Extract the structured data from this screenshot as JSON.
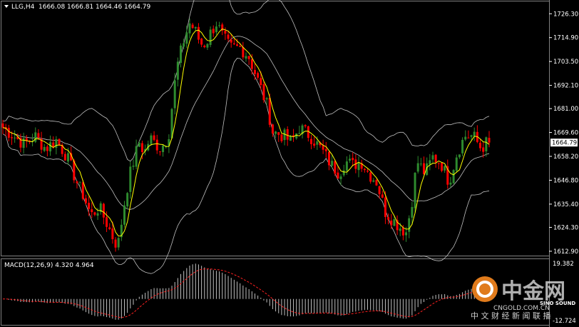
{
  "chart_data": {
    "type": "candlestick",
    "symbol_label": "LLG,H4",
    "ohlc_readout": [
      "1666.08",
      "1666.81",
      "1664.46",
      "1664.79"
    ],
    "current_price": 1664.79,
    "current_price_label": "1664.79",
    "price_ticks": [
      1726.3,
      1714.9,
      1703.5,
      1692.1,
      1681.0,
      1669.6,
      1658.2,
      1646.8,
      1635.4,
      1624.3,
      1612.9
    ],
    "price_tick_labels": [
      "1726.30",
      "1714.90",
      "1703.50",
      "1692.10",
      "1681.00",
      "1669.60",
      "1658.20",
      "1646.80",
      "1635.40",
      "1624.30",
      "1612.90"
    ],
    "ylim": [
      1611.5,
      1731.5
    ],
    "bull_color": "#2e8b2e",
    "bear_color": "#ff0000",
    "candle_count": 165,
    "indicators": {
      "bollinger_color": "#c0c0c0",
      "moving_average_color": "#ffff00"
    },
    "anchors": [
      [
        0,
        1672
      ],
      [
        4,
        1668
      ],
      [
        8,
        1664
      ],
      [
        12,
        1668
      ],
      [
        16,
        1662
      ],
      [
        20,
        1666
      ],
      [
        24,
        1658
      ],
      [
        28,
        1645
      ],
      [
        30,
        1640
      ],
      [
        33,
        1630
      ],
      [
        36,
        1634
      ],
      [
        39,
        1626
      ],
      [
        41,
        1620
      ],
      [
        43,
        1615
      ],
      [
        46,
        1640
      ],
      [
        48,
        1652
      ],
      [
        51,
        1665
      ],
      [
        53,
        1660
      ],
      [
        55,
        1667
      ],
      [
        59,
        1662
      ],
      [
        62,
        1668
      ],
      [
        65,
        1700
      ],
      [
        68,
        1715
      ],
      [
        70,
        1722
      ],
      [
        72,
        1718
      ],
      [
        74,
        1712
      ],
      [
        76,
        1712
      ],
      [
        78,
        1718
      ],
      [
        80,
        1722
      ],
      [
        82,
        1716
      ],
      [
        85,
        1710
      ],
      [
        89,
        1710
      ],
      [
        92,
        1706
      ],
      [
        95,
        1696
      ],
      [
        99,
        1682
      ],
      [
        101,
        1670
      ],
      [
        105,
        1668
      ],
      [
        108,
        1665
      ],
      [
        111,
        1672
      ],
      [
        113,
        1670
      ],
      [
        115,
        1668
      ],
      [
        117,
        1665
      ],
      [
        120,
        1660
      ],
      [
        123,
        1654
      ],
      [
        126,
        1650
      ],
      [
        128,
        1656
      ],
      [
        131,
        1654
      ],
      [
        134,
        1656
      ],
      [
        137,
        1650
      ],
      [
        140,
        1646
      ],
      [
        143,
        1632
      ],
      [
        146,
        1628
      ],
      [
        149,
        1624
      ],
      [
        151,
        1622
      ],
      [
        153,
        1636
      ],
      [
        155,
        1656
      ],
      [
        158,
        1650
      ],
      [
        161,
        1658
      ],
      [
        164,
        1655
      ],
      [
        167,
        1646
      ],
      [
        170,
        1660
      ],
      [
        173,
        1668
      ],
      [
        176,
        1668
      ],
      [
        179,
        1662
      ],
      [
        182,
        1666
      ]
    ],
    "macd": {
      "label": "MACD(12,26,9) 4.320 4.964",
      "upper_label": "19.382",
      "lower_label": "-12.724",
      "ylim": [
        -12.724,
        19.382
      ],
      "histogram_color": "#c0c0c0",
      "signal_color": "#ff2020"
    }
  },
  "watermark": {
    "logo_text": "中金网",
    "sub_text": "CNGOLD.COM.CN",
    "chinese_text": "中 文 财 经 新 闻 联 播",
    "brand_text": "SINO SOUND"
  }
}
